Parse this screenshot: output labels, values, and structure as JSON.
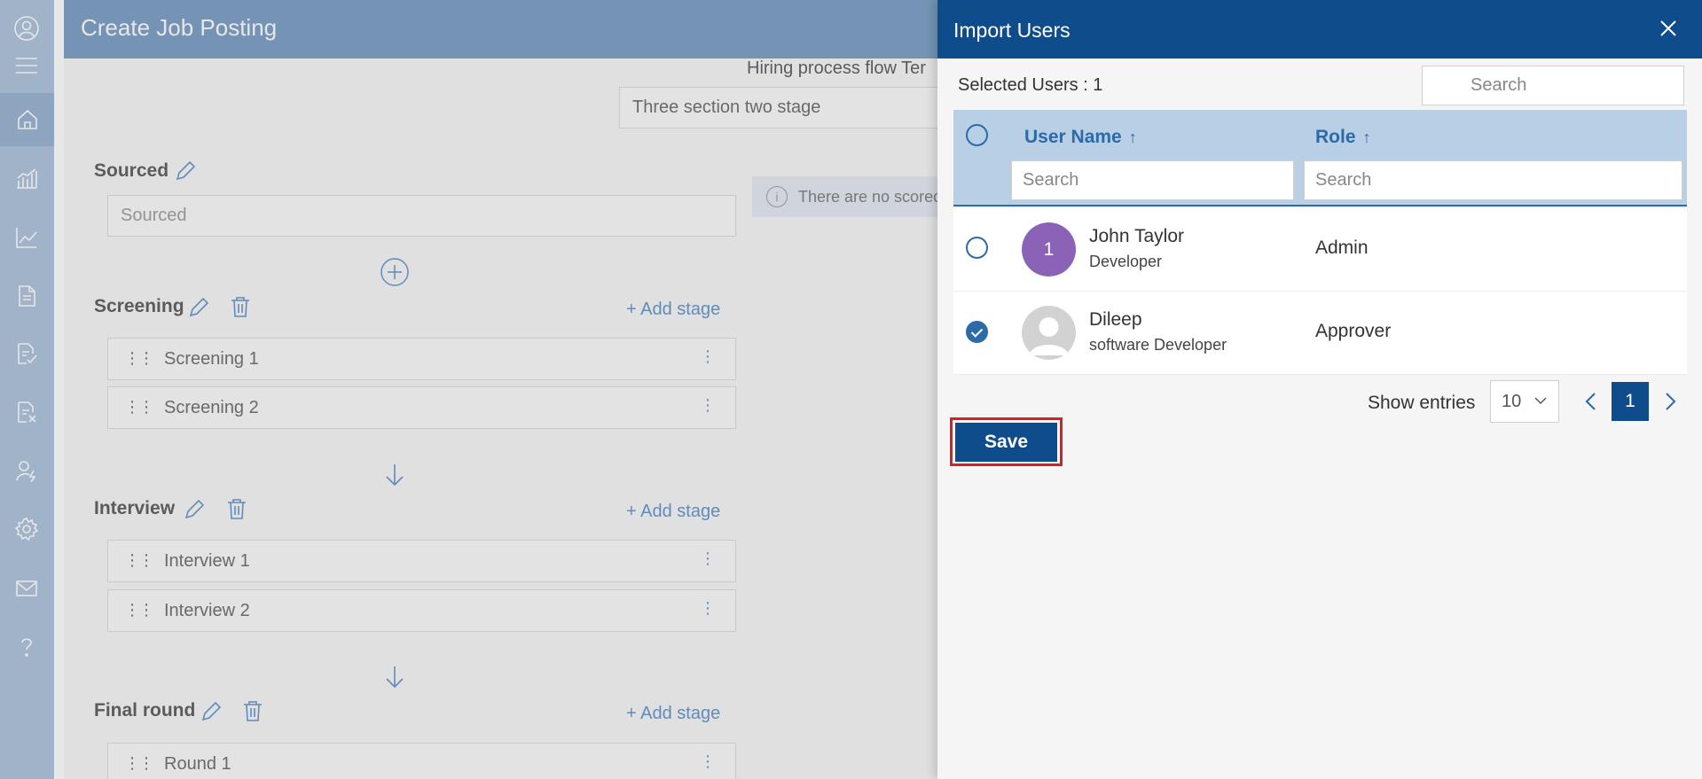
{
  "page": {
    "title": "Create Job Posting",
    "hiring_label": "Hiring process flow Ter",
    "template_value": "Three section two stage",
    "info_text": "There are no scored"
  },
  "sections": {
    "sourced": {
      "title": "Sourced",
      "placeholder": "Sourced"
    },
    "screening": {
      "title": "Screening",
      "add_stage": "+ Add stage",
      "stages": [
        "Screening 1",
        "Screening 2"
      ]
    },
    "interview": {
      "title": "Interview",
      "add_stage": "+ Add stage",
      "stages": [
        "Interview 1",
        "Interview 2"
      ]
    },
    "final": {
      "title": "Final round",
      "add_stage": "+ Add stage",
      "stages": [
        "Round 1"
      ]
    }
  },
  "sidebar": {
    "icons": [
      "user-circle-icon",
      "menu-icon",
      "home-icon",
      "bar-chart-icon",
      "line-chart-icon",
      "document-icon",
      "document-check-icon",
      "document-cross-icon",
      "user-key-icon",
      "gear-icon",
      "mail-icon",
      "help-icon"
    ]
  },
  "panel": {
    "title": "Import Users",
    "selected_users": "Selected Users : 1",
    "search_placeholder": "Search",
    "columns": {
      "name": "User Name",
      "role": "Role",
      "sort_arrow": "↑"
    },
    "column_search_placeholder": "Search",
    "rows": [
      {
        "avatar_initial": "1",
        "name": "John Taylor",
        "subtitle": "Developer",
        "role": "Admin",
        "checked": false
      },
      {
        "avatar_initial": "",
        "name": "Dileep",
        "subtitle": "software Developer",
        "role": "Approver",
        "checked": true
      }
    ],
    "show_entries_label": "Show entries",
    "entries_value": "10",
    "current_page": "1",
    "save_label": "Save"
  },
  "colors": {
    "panel_header": "#0f4c8c",
    "accent": "#2c6aa8",
    "page_header": "#7399c3",
    "rail": "#a9c0db",
    "highlight": "#d81f26"
  }
}
